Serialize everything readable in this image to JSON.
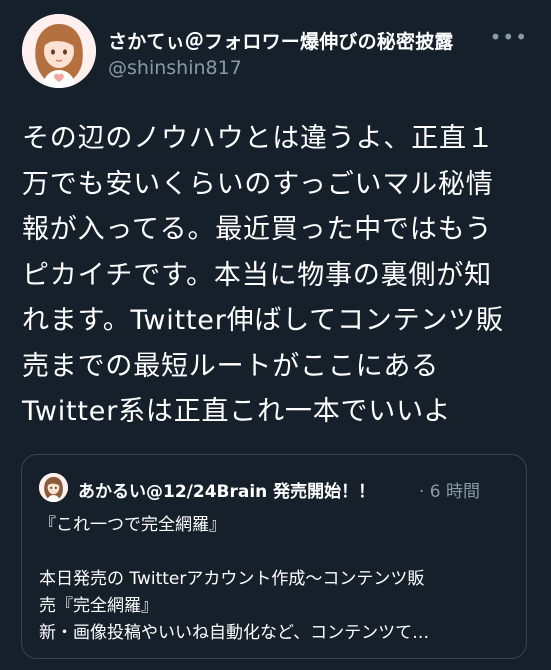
{
  "author": {
    "display_name": "さかてぃ＠フォロワー爆伸びの秘密披露",
    "handle": "@shinshin817"
  },
  "menu": {
    "more_label": "•••"
  },
  "tweet": {
    "lines": [
      "その辺のノウハウとは違うよ、正直１",
      "万でも安いくらいのすっごいマル秘情",
      "報が入ってる。最近買った中ではもう",
      "ピカイチです。本当に物事の裏側が知",
      "れます。Twitter伸ばしてコンテンツ販",
      "売までの最短ルートがここにある",
      "Twitter系は正直これ一本でいいよ"
    ]
  },
  "quoted_tweet": {
    "display_name": "あかるい@12/24Brain 発売開始！！",
    "time": "· 6 時間",
    "lines": [
      "『これ一つで完全網羅』",
      "",
      "本日発売の Twitterアカウント作成〜コンテンツ販",
      "売『完全網羅』",
      "新・画像投稿やいいね自動化など、コンテンツて…"
    ]
  },
  "colors": {
    "background": "#15202b",
    "text_primary": "#ffffff",
    "text_secondary": "#8b98a5",
    "border": "#38444d"
  },
  "icons": {
    "avatar": "avatar-illustration",
    "more": "more-horizontal-icon"
  }
}
